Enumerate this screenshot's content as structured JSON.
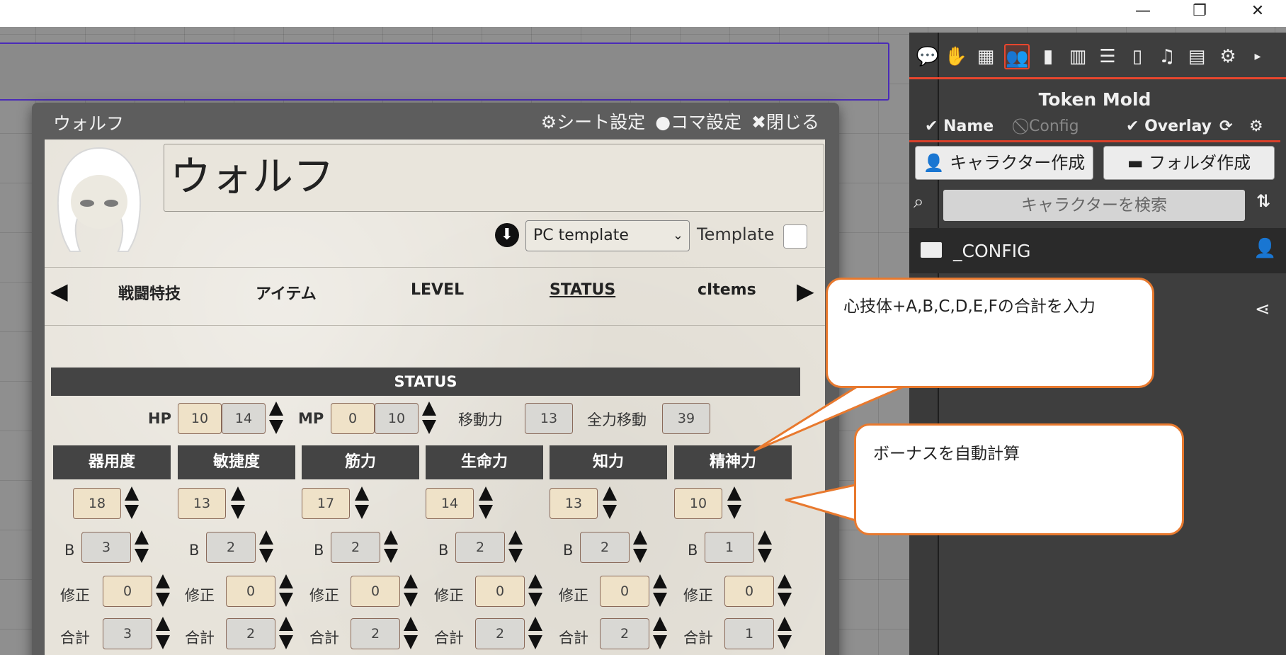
{
  "window": {
    "minimize_glyph": "—",
    "restore_glyph": "❐",
    "close_glyph": "✕"
  },
  "dialog": {
    "title": "ウォルフ",
    "sheet_settings": "シート設定",
    "token_settings": "コマ設定",
    "close": "閉じる"
  },
  "sheet": {
    "character_name": "ウォルフ",
    "template_select": "PC template",
    "template_label": "Template",
    "tabs": [
      "戦闘特技",
      "アイテム",
      "LEVEL",
      "STATUS",
      "cItems"
    ],
    "active_tab": "STATUS",
    "status_header": "STATUS",
    "hp_label": "HP",
    "hp_current": "10",
    "hp_max": "14",
    "mp_label": "MP",
    "mp_current": "0",
    "mp_max": "10",
    "move_label": "移動力",
    "move_value": "13",
    "fullmove_label": "全力移動",
    "fullmove_value": "39",
    "b_label": "B",
    "mod_label": "修正",
    "total_label": "合計",
    "attributes": [
      {
        "name": "器用度",
        "value": "18",
        "bonus": "3",
        "mod": "0",
        "total": "3"
      },
      {
        "name": "敏捷度",
        "value": "13",
        "bonus": "2",
        "mod": "0",
        "total": "2"
      },
      {
        "name": "筋力",
        "value": "17",
        "bonus": "2",
        "mod": "0",
        "total": "2"
      },
      {
        "name": "生命力",
        "value": "14",
        "bonus": "2",
        "mod": "0",
        "total": "2"
      },
      {
        "name": "知力",
        "value": "13",
        "bonus": "2",
        "mod": "0",
        "total": "2"
      },
      {
        "name": "精神力",
        "value": "10",
        "bonus": "1",
        "mod": "0",
        "total": "1"
      }
    ]
  },
  "callouts": {
    "top": "心技体+A,B,C,D,E,Fの合計を入力",
    "bottom": "ボーナスを自動計算"
  },
  "panel": {
    "title": "Token Mold",
    "name_toggle": "Name",
    "config_toggle": "Config",
    "overlay_toggle": "Overlay",
    "create_character": "キャラクター作成",
    "create_folder": "フォルダ作成",
    "search_placeholder": "キャラクターを検索",
    "folder_name": "_CONFIG"
  },
  "colors": {
    "accent_orange": "#e8792e",
    "accent_red": "#e8462e",
    "panel_bg": "#3e3e3e",
    "header_dark": "#444444"
  }
}
